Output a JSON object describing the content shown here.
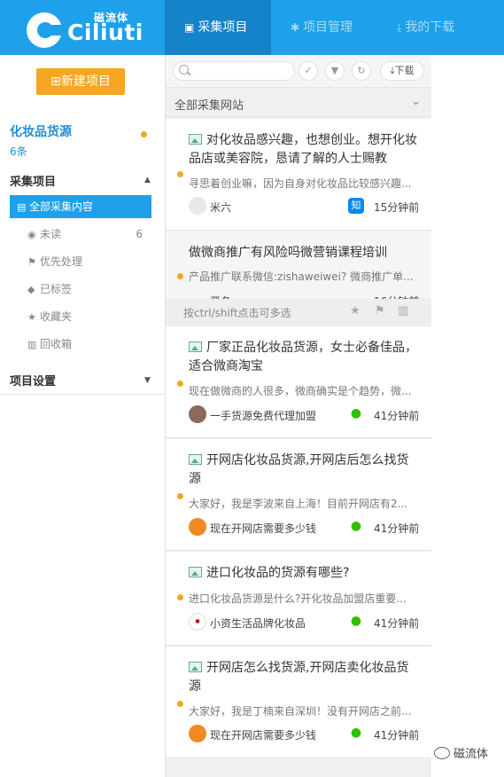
{
  "app": {
    "logo_cn": "磁流体",
    "logo_en": "Ciliuti"
  },
  "nav": {
    "tabs": [
      {
        "label": "采集项目",
        "icon": "save-icon"
      },
      {
        "label": "项目管理",
        "icon": "gear-icon"
      },
      {
        "label": "我的下载",
        "icon": "download-icon"
      }
    ]
  },
  "sidebar": {
    "new_project": "新建项目",
    "source_title": "化妆品货源",
    "source_count": "6条",
    "section_collect": "采集项目",
    "items": [
      {
        "label": "全部采集内容",
        "icon": "list-icon",
        "count": ""
      },
      {
        "label": "未读",
        "icon": "eye-icon",
        "count": "6"
      },
      {
        "label": "优先处理",
        "icon": "flag-icon",
        "count": ""
      },
      {
        "label": "已标签",
        "icon": "tag-icon",
        "count": ""
      },
      {
        "label": "收藏夹",
        "icon": "star-icon",
        "count": ""
      },
      {
        "label": "回收箱",
        "icon": "trash-icon",
        "count": ""
      }
    ],
    "section_settings": "项目设置"
  },
  "toolbar": {
    "search_placeholder": "",
    "download_label": "下载"
  },
  "filter": {
    "label": "全部采集网站"
  },
  "hint": {
    "text": "按ctrl/shift点击可多选"
  },
  "articles": [
    {
      "title": "对化妆品感兴趣，也想创业。想开化妆品店或美容院，恳请了解的人士赐教",
      "summary": "寻思着创业嘛，因为自身对化妆品比较感兴趣...",
      "author": "米六",
      "source": "知",
      "time": "15分钟前"
    },
    {
      "title": "做微商推广有风险吗微营销课程培训",
      "summary": "产品推广联系微信:zishaweiwei? 微商推广单...",
      "author": "严冬",
      "source": "",
      "time": "16分钟前"
    },
    {
      "title": "厂家正品化妆品货源，女士必备佳品，适合微商淘宝",
      "summary": "现在做微商的人很多，微商确实是个趋势，微...",
      "author": "一手货源免费代理加盟",
      "source": "wechat",
      "time": "41分钟前"
    },
    {
      "title": "开网店化妆品货源,开网店后怎么找货源",
      "summary": "大家好，我是李波来自上海！目前开网店有2...",
      "author": "现在开网店需要多少钱",
      "source": "wechat",
      "time": "41分钟前"
    },
    {
      "title": "进口化妆品的货源有哪些?",
      "summary": "进口化妆品货源是什么?开化妆品加盟店重要...",
      "author": "小资生活品牌化妆品",
      "source": "wechat",
      "time": "41分钟前"
    },
    {
      "title": "开网店怎么找货源,开网店卖化妆品货源",
      "summary": "大家好，我是丁楠来自深圳！没有开网店之前...",
      "author": "现在开网店需要多少钱",
      "source": "wechat",
      "time": "41分钟前"
    }
  ],
  "watermark": "磁流体",
  "colors": {
    "primary": "#1ea0ea",
    "primary_dark": "#1583c9",
    "accent": "#f5a623",
    "wechat": "#2dc100",
    "zhihu": "#0f88eb"
  }
}
